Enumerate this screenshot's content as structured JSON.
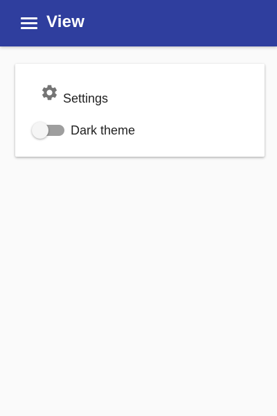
{
  "app_bar": {
    "title": "View",
    "menu_icon": "hamburger-menu-icon",
    "background_color": "#2f3e9e"
  },
  "card": {
    "settings": {
      "icon": "gear-icon",
      "label": "Settings"
    },
    "dark_theme_toggle": {
      "label": "Dark theme",
      "checked": false
    }
  }
}
